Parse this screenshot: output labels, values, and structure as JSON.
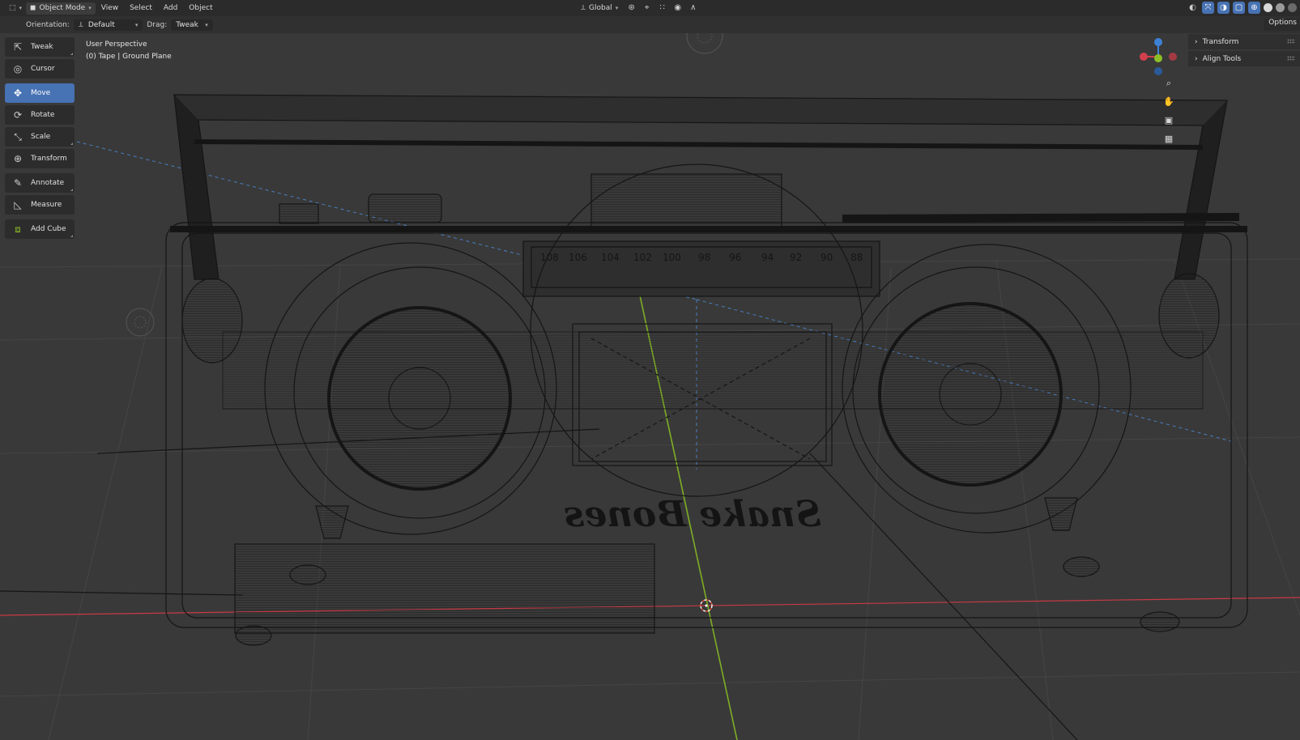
{
  "header": {
    "editor_icon": "viewport-icon",
    "mode": "Object Mode",
    "menus": [
      "View",
      "Select",
      "Add",
      "Object"
    ],
    "transform_space": "Global"
  },
  "tool_settings": {
    "orientation_label": "Orientation:",
    "orientation_value": "Default",
    "drag_label": "Drag:",
    "drag_value": "Tweak",
    "options_label": "Options"
  },
  "tools": [
    {
      "label": "Tweak",
      "icon": "tweak-icon"
    },
    {
      "label": "Cursor",
      "icon": "cursor-icon"
    },
    {
      "label": "Move",
      "icon": "move-icon",
      "active": true
    },
    {
      "label": "Rotate",
      "icon": "rotate-icon"
    },
    {
      "label": "Scale",
      "icon": "scale-icon"
    },
    {
      "label": "Transform",
      "icon": "transform-icon"
    },
    {
      "label": "Annotate",
      "icon": "annotate-icon"
    },
    {
      "label": "Measure",
      "icon": "measure-icon"
    },
    {
      "label": "Add Cube",
      "icon": "add-cube-icon"
    }
  ],
  "viewport": {
    "perspective": "User Perspective",
    "object_info": "(0) Tape | Ground Plane",
    "dial_left": [
      "108",
      "106",
      "104",
      "102",
      "100",
      "98"
    ],
    "dial_right": [
      "96",
      "94",
      "92",
      "90",
      "88"
    ],
    "logo_text": "Snake Bones"
  },
  "npanel": {
    "sections": [
      "Transform",
      "Align Tools"
    ]
  },
  "colors": {
    "accent": "#4772b3",
    "x_axis": "#d0404c",
    "y_axis": "#8cbf26",
    "z_axis": "#3d82d6",
    "wire": "#141414"
  }
}
